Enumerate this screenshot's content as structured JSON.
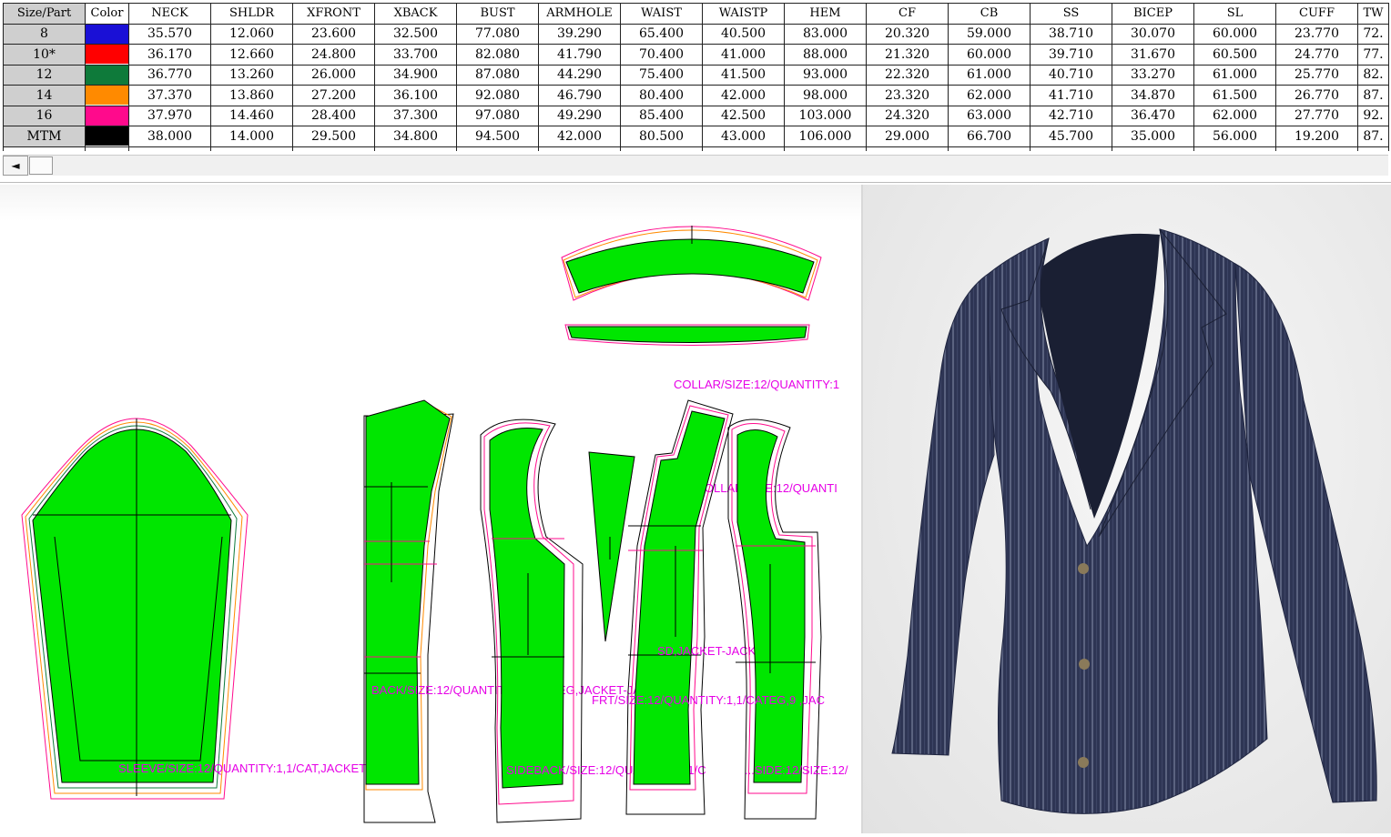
{
  "table": {
    "headers": [
      "Size/Part",
      "Color",
      "NECK",
      "SHLDR",
      "XFRONT",
      "XBACK",
      "BUST",
      "ARMHOLE",
      "WAIST",
      "WAISTP",
      "HEM",
      "CF",
      "CB",
      "SS",
      "BICEP",
      "SL",
      "CUFF",
      "TW"
    ],
    "rows": [
      {
        "size": "8",
        "color": "#1a10d6",
        "values": [
          "35.570",
          "12.060",
          "23.600",
          "32.500",
          "77.080",
          "39.290",
          "65.400",
          "40.500",
          "83.000",
          "20.320",
          "59.000",
          "38.710",
          "30.070",
          "60.000",
          "23.770",
          "72."
        ]
      },
      {
        "size": "10*",
        "color": "#ff0000",
        "values": [
          "36.170",
          "12.660",
          "24.800",
          "33.700",
          "82.080",
          "41.790",
          "70.400",
          "41.000",
          "88.000",
          "21.320",
          "60.000",
          "39.710",
          "31.670",
          "60.500",
          "24.770",
          "77."
        ]
      },
      {
        "size": "12",
        "color": "#0e7a3a",
        "values": [
          "36.770",
          "13.260",
          "26.000",
          "34.900",
          "87.080",
          "44.290",
          "75.400",
          "41.500",
          "93.000",
          "22.320",
          "61.000",
          "40.710",
          "33.270",
          "61.000",
          "25.770",
          "82."
        ]
      },
      {
        "size": "14",
        "color": "#ff8a00",
        "values": [
          "37.370",
          "13.860",
          "27.200",
          "36.100",
          "92.080",
          "46.790",
          "80.400",
          "42.000",
          "98.000",
          "23.320",
          "62.000",
          "41.710",
          "34.870",
          "61.500",
          "26.770",
          "87."
        ]
      },
      {
        "size": "16",
        "color": "#ff0a8c",
        "values": [
          "37.970",
          "14.460",
          "28.400",
          "37.300",
          "97.080",
          "49.290",
          "85.400",
          "42.500",
          "103.000",
          "24.320",
          "63.000",
          "42.710",
          "36.470",
          "62.000",
          "27.770",
          "92."
        ]
      },
      {
        "size": "MTM",
        "color": "#000000",
        "values": [
          "38.000",
          "14.000",
          "29.500",
          "34.800",
          "94.500",
          "42.000",
          "80.500",
          "43.000",
          "106.000",
          "29.000",
          "66.700",
          "45.700",
          "35.000",
          "56.000",
          "19.200",
          "87."
        ]
      }
    ]
  },
  "scrollbar": {
    "left_arrow": "◄"
  },
  "pattern_labels": {
    "collar": "COLLAR/SIZE:12/QUANTITY:1",
    "topcollar": "TOPCOLLAR/SIZE:12/QUANTI",
    "sleeve": "SLEEVE/SIZE:12/QUANTITY:1,1/CAT,JACKET-JACKET",
    "back": "BACK/SIZE:12/QUANTITY:1,1/CATEG,JACKET-JACKET",
    "front": "FRT/SIZE:12/QUANTITY:1,1/CATEG,9 ,JAC",
    "side": "SD,JACKET-JACKET",
    "sideback": "SIDEBACK/SIZE:12/QUANTITY:1,1/C",
    "sideback_overlap": "...SIDE:12/SIZE:12/"
  },
  "colors": {
    "piece_fill": "#00e600",
    "label": "#e600e6",
    "jacket": "#2d3552"
  }
}
